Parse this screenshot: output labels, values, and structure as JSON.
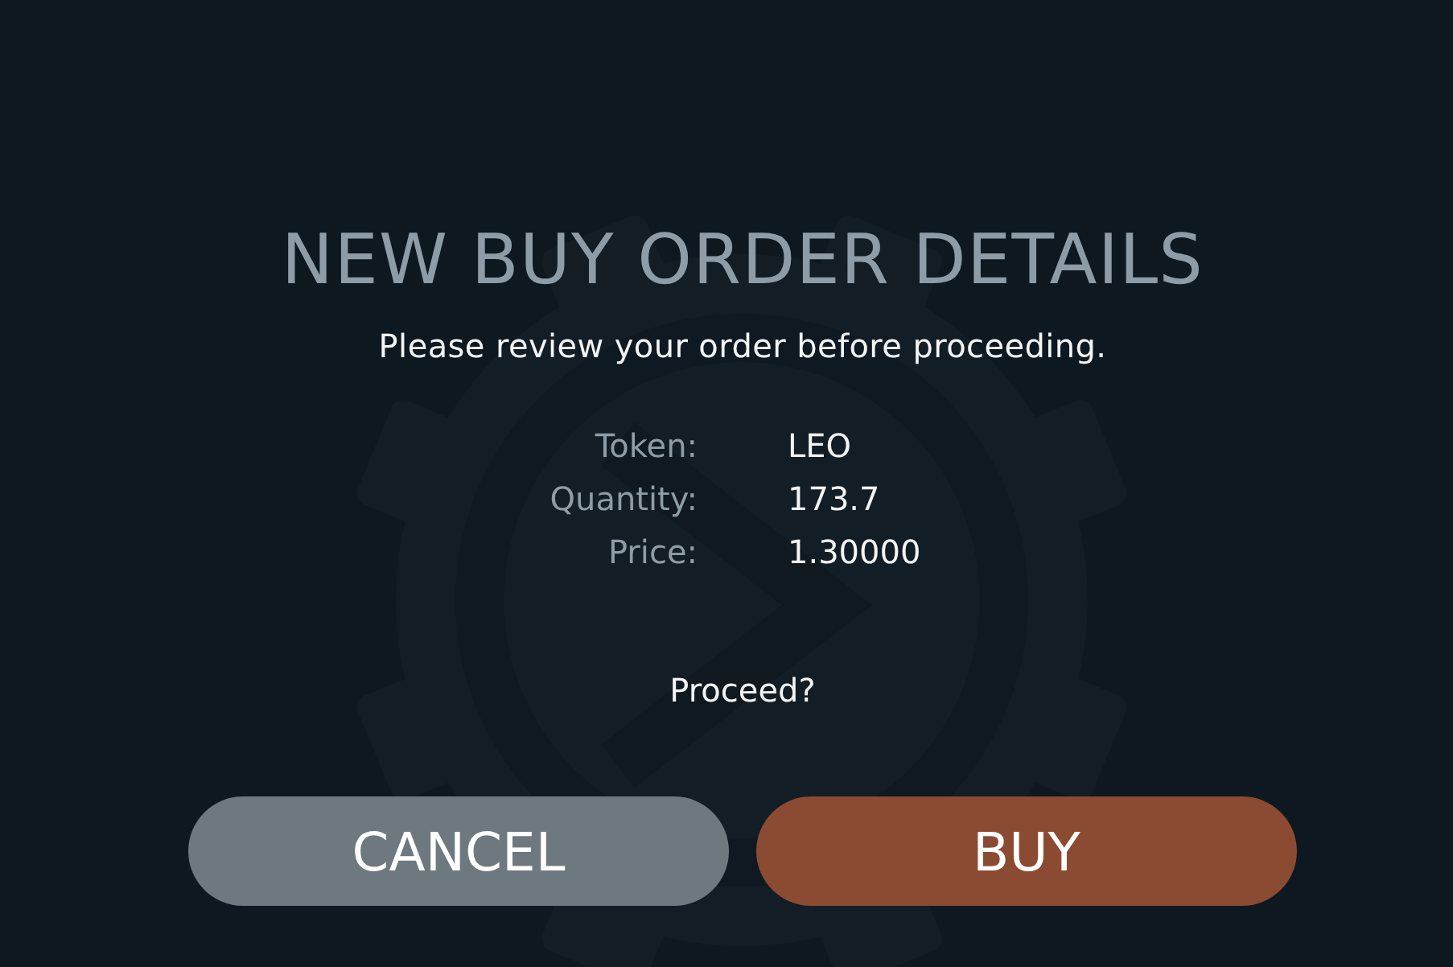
{
  "title": "NEW BUY ORDER DETAILS",
  "subtitle": "Please review your order before proceeding.",
  "details": [
    {
      "label": "Token:",
      "value": "LEO"
    },
    {
      "label": "Quantity:",
      "value": "173.7"
    },
    {
      "label": "Price:",
      "value": "1.30000"
    }
  ],
  "prompt": "Proceed?",
  "buttons": [
    {
      "label": "CANCEL",
      "kind": "cancel"
    },
    {
      "label": "BUY",
      "kind": "confirm"
    }
  ]
}
